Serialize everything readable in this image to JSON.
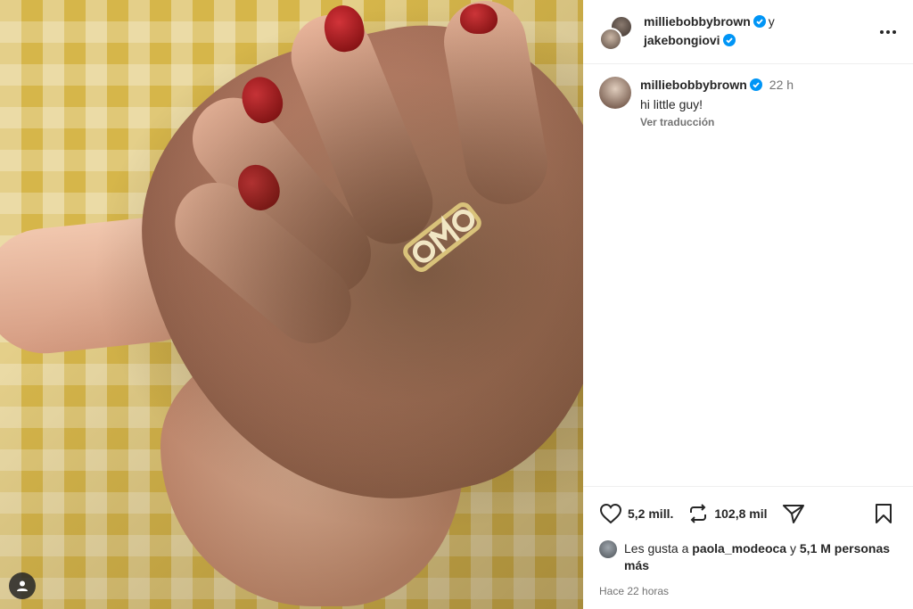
{
  "header": {
    "user1": "milliebobbybrown",
    "joiner": "y",
    "user2": "jakebongiovi",
    "more_icon": "more-horizontal-icon"
  },
  "caption": {
    "username": "milliebobbybrown",
    "time": "22 h",
    "text": "hi little guy!",
    "translate": "Ver traducción"
  },
  "actions": {
    "like_count": "5,2 mill.",
    "repost_count": "102,8 mil",
    "like_icon": "heart-icon",
    "repost_icon": "repost-icon",
    "share_icon": "send-icon",
    "save_icon": "bookmark-icon"
  },
  "likes": {
    "prefix": "Les gusta a",
    "user": "paola_modeoca",
    "middle": "y",
    "others": "5,1 M personas más"
  },
  "posted": "Hace 22 horas",
  "colors": {
    "verified": "#0095f6",
    "text_primary": "#262626",
    "text_secondary": "#737373"
  }
}
